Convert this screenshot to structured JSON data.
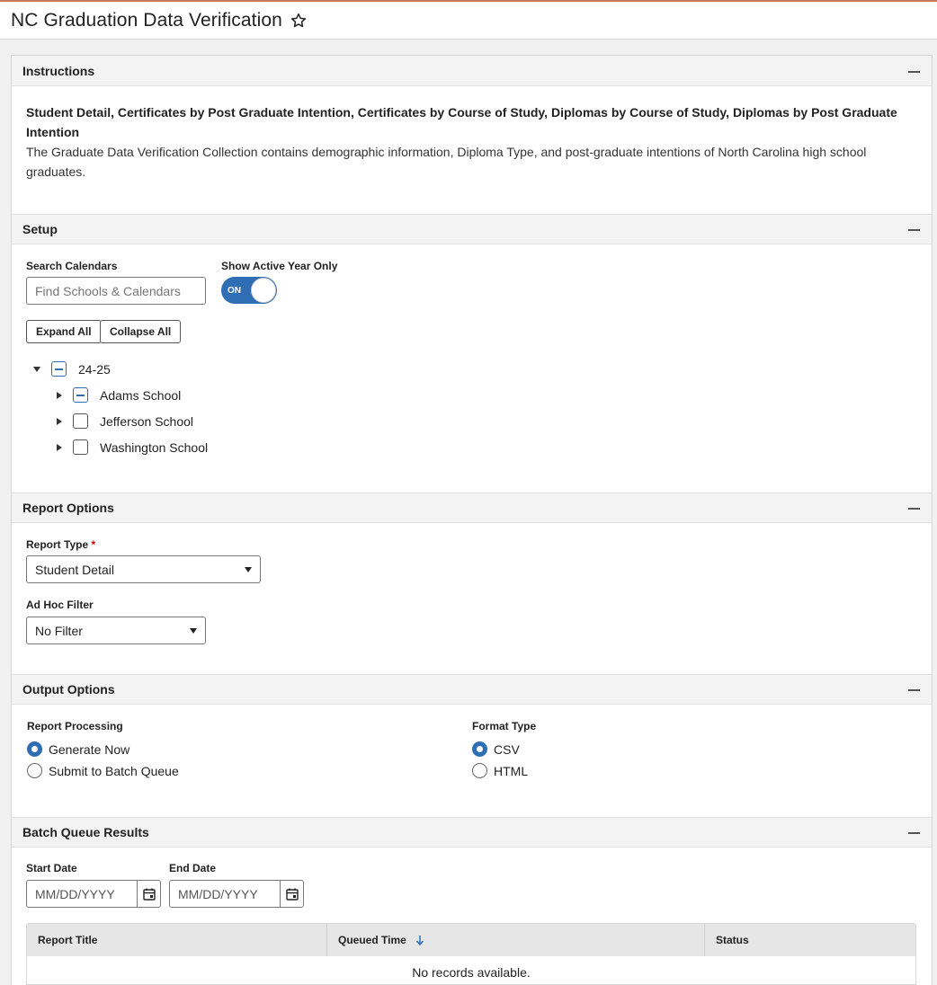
{
  "page": {
    "title": "NC Graduation Data Verification"
  },
  "icons": {
    "favorite": "star-outline-icon",
    "collapse": "minus-icon",
    "calendar": "calendar-icon",
    "sort": "arrow-down-icon"
  },
  "colors": {
    "accent": "#2f6db5",
    "required": "#cc0000"
  },
  "instructions": {
    "title": "Instructions",
    "heading": "Student Detail, Certificates by Post Graduate Intention, Certificates by Course of Study, Diplomas by Course of Study, Diplomas by Post Graduate Intention",
    "text": "The Graduate Data Verification Collection contains demographic information, Diploma Type, and post-graduate intentions of North Carolina high school graduates."
  },
  "setup": {
    "title": "Setup",
    "search_label": "Search Calendars",
    "search_placeholder": "Find Schools & Calendars",
    "toggle_label": "Show Active Year Only",
    "toggle_state": "ON",
    "expand_all": "Expand All",
    "collapse_all": "Collapse All",
    "tree": {
      "year": "24-25",
      "schools": [
        "Adams School",
        "Jefferson School",
        "Washington School"
      ]
    }
  },
  "report_options": {
    "title": "Report Options",
    "report_type_label": "Report Type",
    "required_mark": "*",
    "report_type_value": "Student Detail",
    "adhoc_label": "Ad Hoc Filter",
    "adhoc_value": "No Filter"
  },
  "output_options": {
    "title": "Output Options",
    "processing_label": "Report Processing",
    "processing_options": [
      "Generate Now",
      "Submit to Batch Queue"
    ],
    "processing_selected": "Generate Now",
    "format_label": "Format Type",
    "format_options": [
      "CSV",
      "HTML"
    ],
    "format_selected": "CSV"
  },
  "batch_queue": {
    "title": "Batch Queue Results",
    "start_label": "Start Date",
    "start_placeholder": "MM/DD/YYYY",
    "end_label": "End Date",
    "end_placeholder": "MM/DD/YYYY",
    "columns": [
      "Report Title",
      "Queued Time",
      "Status"
    ],
    "empty_text": "No records available."
  }
}
